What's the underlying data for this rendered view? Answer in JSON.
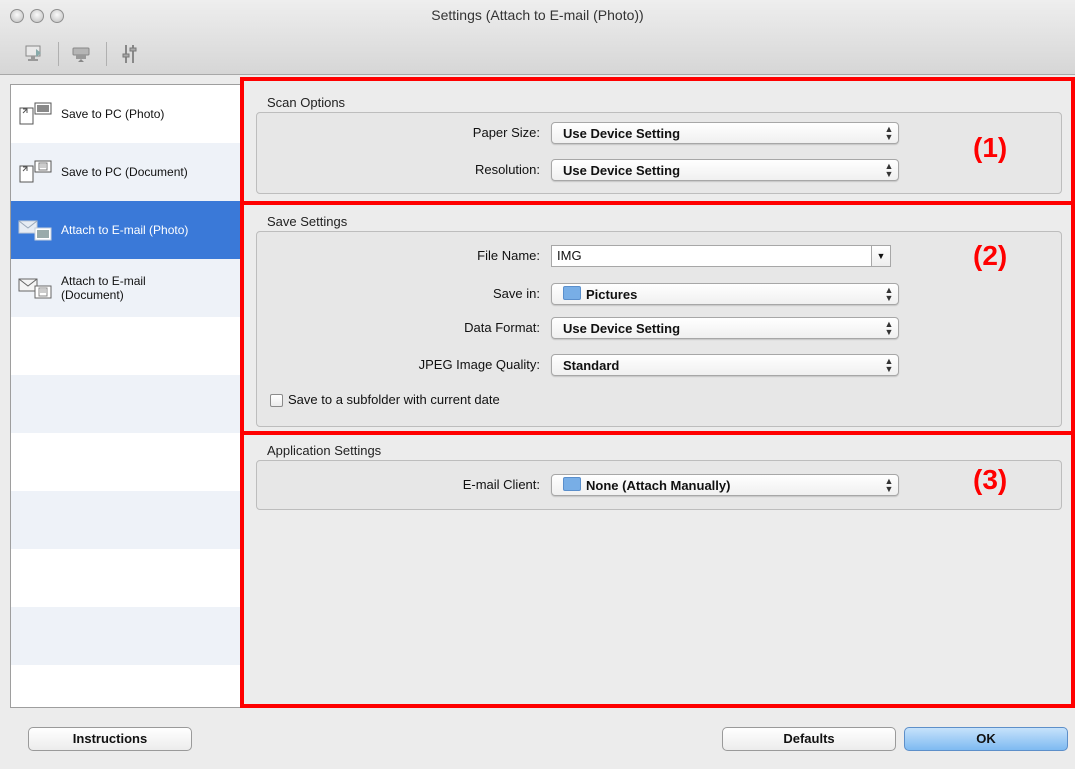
{
  "window": {
    "title": "Settings (Attach to E-mail (Photo))"
  },
  "toolbar": [
    {
      "icon": "scan-from-computer-icon"
    },
    {
      "icon": "scan-from-panel-icon"
    },
    {
      "icon": "general-settings-icon"
    }
  ],
  "sidebar": {
    "items": [
      {
        "label": "Save to PC (Photo)",
        "icon": "save-photo-icon",
        "selected": false
      },
      {
        "label": "Save to PC (Document)",
        "icon": "save-document-icon",
        "selected": false
      },
      {
        "label": "Attach to E-mail (Photo)",
        "icon": "email-photo-icon",
        "selected": true
      },
      {
        "label_line1": "Attach to E-mail",
        "label_line2": "(Document)",
        "icon": "email-document-icon",
        "selected": false
      }
    ]
  },
  "scan_options": {
    "title": "Scan Options",
    "paper_size_label": "Paper Size:",
    "paper_size_value": "Use Device Setting",
    "resolution_label": "Resolution:",
    "resolution_value": "Use Device Setting"
  },
  "save_settings": {
    "title": "Save Settings",
    "file_name_label": "File Name:",
    "file_name_value": "IMG",
    "save_in_label": "Save in:",
    "save_in_value": "Pictures",
    "data_format_label": "Data Format:",
    "data_format_value": "Use Device Setting",
    "jpeg_quality_label": "JPEG Image Quality:",
    "jpeg_quality_value": "Standard",
    "subfolder_label": "Save to a subfolder with current date",
    "subfolder_checked": false
  },
  "application_settings": {
    "title": "Application Settings",
    "email_client_label": "E-mail Client:",
    "email_client_value": "None (Attach Manually)"
  },
  "callouts": {
    "one": "(1)",
    "two": "(2)",
    "three": "(3)"
  },
  "buttons": {
    "instructions": "Instructions",
    "defaults": "Defaults",
    "ok": "OK"
  },
  "colors": {
    "selection": "#3a79d8",
    "callout_red": "#ff0000",
    "ok_button": "#7ebaf1"
  }
}
